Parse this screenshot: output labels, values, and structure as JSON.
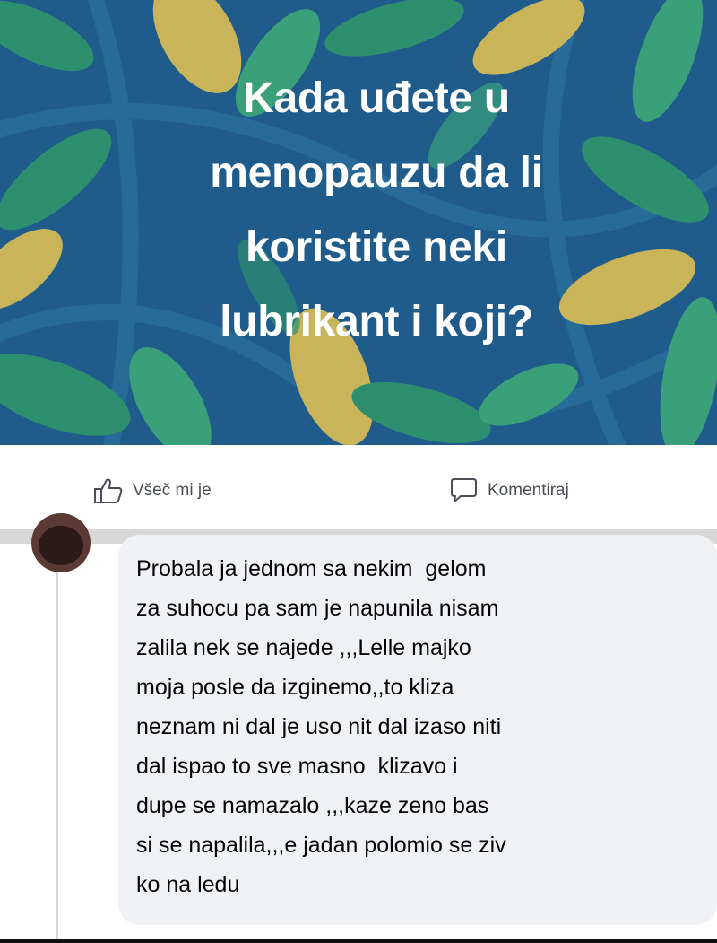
{
  "post": {
    "lines": [
      "Kada uđete u",
      "menopauzu da li",
      "koristite neki",
      "lubrikant i koji?"
    ],
    "background_color": "#1f5c8c",
    "leaf_colors": [
      "#2e8f6e",
      "#c9b45a",
      "#3aa07a",
      "#1b4a78"
    ]
  },
  "actions": {
    "like_label": "Všeč mi je",
    "like_icon": "thumbs-up-icon",
    "comment_label": "Komentiraj",
    "comment_icon": "speech-bubble-icon"
  },
  "comment": {
    "lines": [
      "Probala ja jednom sa nekim  gelom",
      "za suhocu pa sam je napunila nisam",
      "zalila nek se najede ,,,Lelle majko",
      "moja posle da izginemo,,to kliza",
      "neznam ni dal je uso nit dal izaso niti",
      "dal ispao to sve masno  klizavo i",
      "dupe se namazalo ,,,kaze zeno bas",
      "si se napalila,,,e jadan polomio se ziv",
      "ko na ledu"
    ]
  }
}
